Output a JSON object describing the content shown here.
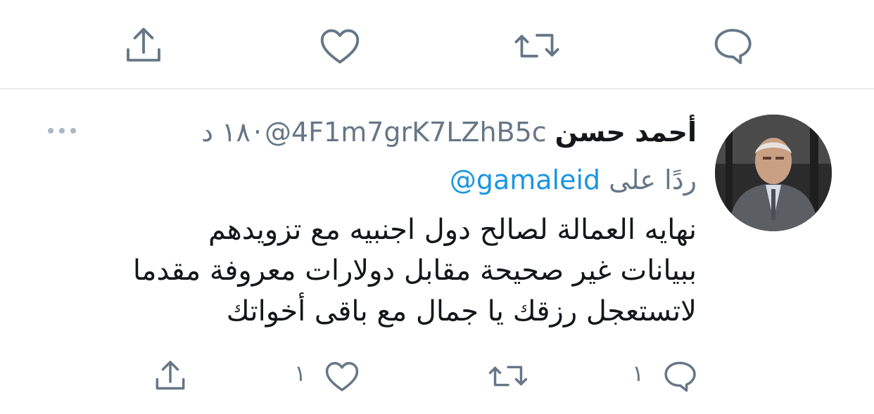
{
  "top_actions": {
    "icons": [
      "share-icon",
      "heart-icon",
      "retweet-icon",
      "reply-icon"
    ]
  },
  "tweet": {
    "author_name": "أحمد حسن",
    "handle": "@4F1m7grK7LZhB5c",
    "separator": "·",
    "time_ago": "١٨ د",
    "reply_prefix": "ردًا على",
    "reply_to": "@gamaleid",
    "text_lines": [
      "نهايه العمالة لصالح دول اجنبيه مع تزويدهم",
      "ببيانات غير صحيحة مقابل دولارات معروفة مقدما",
      "لاتستعجل رزقك يا جمال مع باقى أخواتك"
    ]
  },
  "actions": {
    "reply_count": "١",
    "retweet_count": "",
    "like_count": "١"
  },
  "colors": {
    "text": "#14171a",
    "secondary": "#657786",
    "link": "#1b95e0",
    "icon": "#657786",
    "divider": "#d6d9dc"
  }
}
